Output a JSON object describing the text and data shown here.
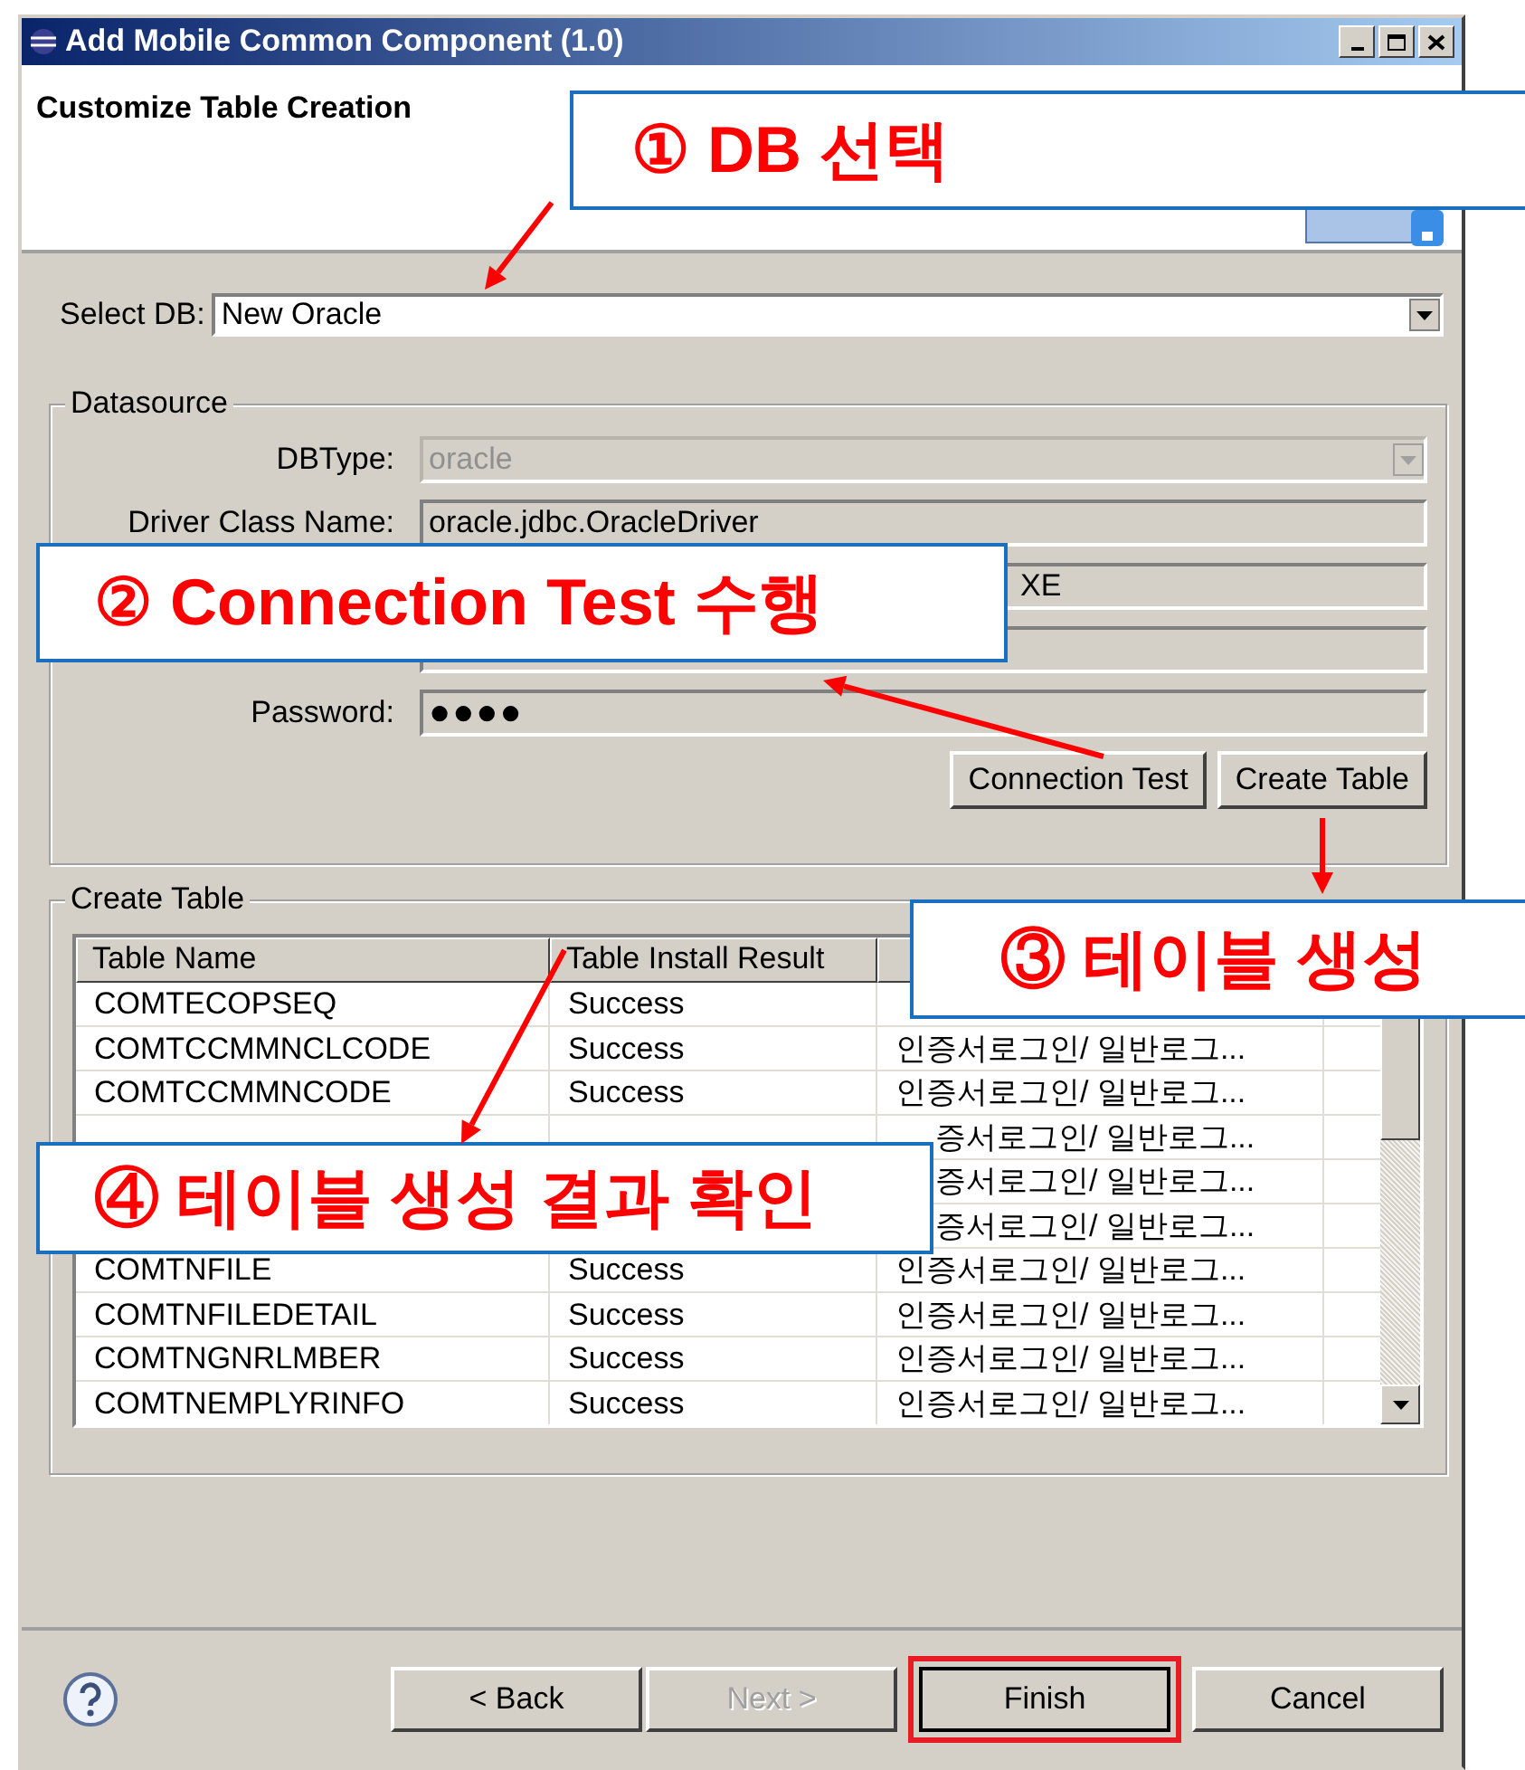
{
  "window": {
    "title": "Add Mobile Common Component (1.0)"
  },
  "page": {
    "title": "Customize Table Creation"
  },
  "select_db": {
    "label": "Select DB:",
    "value": "New Oracle"
  },
  "datasource": {
    "title": "Datasource",
    "fields": [
      {
        "label": "DBType:",
        "value": "oracle",
        "kind": "combo",
        "disabled": true
      },
      {
        "label": "Driver Class Name:",
        "value": "oracle.jdbc.OracleDriver",
        "kind": "text",
        "disabled": false
      },
      {
        "value": "XE",
        "kind": "text",
        "disabled": false
      },
      {
        "kind": "text",
        "disabled": false
      },
      {
        "label": "Password:",
        "value": "●●●●",
        "kind": "password",
        "disabled": false
      }
    ],
    "buttons": [
      "Connection Test",
      "Create Table"
    ]
  },
  "create_table": {
    "title": "Create Table",
    "columns": [
      "Table Name",
      "Table Install Result"
    ],
    "rows": [
      {
        "name": "COMTECOPSEQ",
        "result": "Success"
      },
      {
        "name": "COMTCCMMNCLCODE",
        "result": "Success",
        "column_3": "인증서로그인/ 일반로그..."
      },
      {
        "name": "COMTCCMMNCODE",
        "result": "Success",
        "column_3": "인증서로그인/ 일반로그..."
      },
      {
        "column_3": "증서로그인/ 일반로그..."
      },
      {
        "column_3": "증서로그인/ 일반로그..."
      },
      {
        "column_3": "증서로그인/ 일반로그..."
      },
      {
        "name": "COMTNFILE",
        "result": "Success",
        "column_3": "인증서로그인/ 일반로그..."
      },
      {
        "name": "COMTNFILEDETAIL",
        "result": "Success",
        "column_3": "인증서로그인/ 일반로그..."
      },
      {
        "name": "COMTNGNRLMBER",
        "result": "Success",
        "column_3": "인증서로그인/ 일반로그..."
      },
      {
        "name": "COMTNEMPLYRINFO",
        "result": "Success",
        "column_3": "인증서로그인/ 일반로그..."
      }
    ]
  },
  "footer": {
    "buttons": [
      {
        "label": "< Back",
        "disabled": false,
        "highlighted": false
      },
      {
        "label": "Next >",
        "disabled": true,
        "highlighted": false
      },
      {
        "label": "Finish",
        "disabled": false,
        "highlighted": true
      },
      {
        "label": "Cancel",
        "disabled": false,
        "highlighted": false
      }
    ]
  },
  "callouts": [
    {
      "text": "① DB 선택"
    },
    {
      "text": "② Connection Test 수행"
    },
    {
      "text": "③ 테이블 생성"
    },
    {
      "text": "④ 테이블 생성 결과 확인"
    }
  ]
}
